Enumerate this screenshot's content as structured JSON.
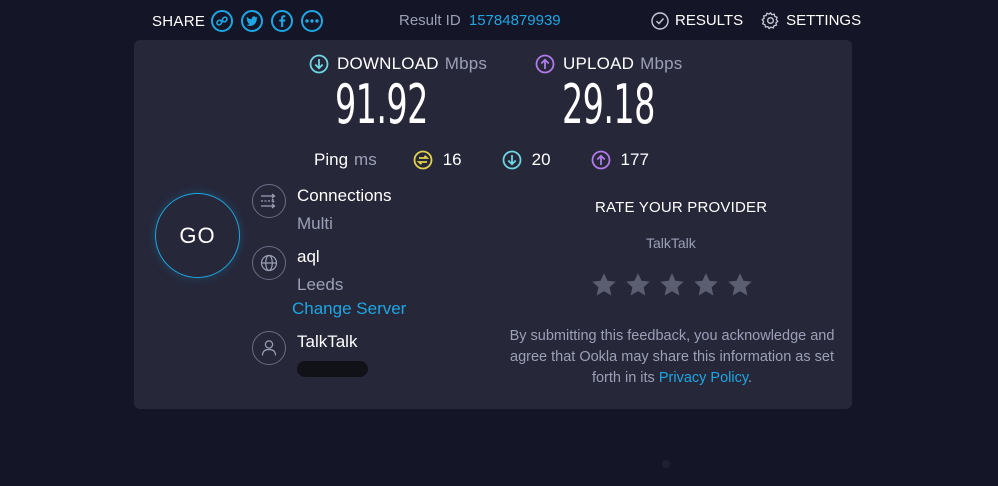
{
  "header": {
    "share_label": "SHARE",
    "share_buttons": [
      "link-icon",
      "twitter-icon",
      "facebook-icon",
      "more-icon"
    ],
    "result_label": "Result ID",
    "result_id": "15784879939",
    "results_label": "RESULTS",
    "settings_label": "SETTINGS"
  },
  "download": {
    "label": "DOWNLOAD",
    "unit": "Mbps",
    "value": "91.92",
    "icon": "arrow-down-circle-icon"
  },
  "upload": {
    "label": "UPLOAD",
    "unit": "Mbps",
    "value": "29.18",
    "icon": "arrow-up-circle-icon"
  },
  "ping": {
    "label": "Ping",
    "unit": "ms",
    "idle": "16",
    "download": "20",
    "upload": "177"
  },
  "go_button": "GO",
  "connections": {
    "title": "Connections",
    "value": "Multi"
  },
  "server": {
    "name": "aql",
    "location": "Leeds",
    "change_label": "Change Server"
  },
  "provider": {
    "name": "TalkTalk"
  },
  "rating": {
    "title": "RATE YOUR PROVIDER",
    "provider": "TalkTalk",
    "star_count": 5,
    "feedback_before": "By submitting this feedback, you acknowledge and agree that Ookla may share this information as set forth in its ",
    "privacy_link": "Privacy Policy",
    "feedback_after": "."
  },
  "colors": {
    "background": "#141526",
    "card": "#262739",
    "accent_blue": "#1ea6e3",
    "accent_cyan": "#6ed6e3",
    "accent_purple": "#b07ae8",
    "ping_yellow": "#e3d24b",
    "muted": "#9ca0b6"
  }
}
